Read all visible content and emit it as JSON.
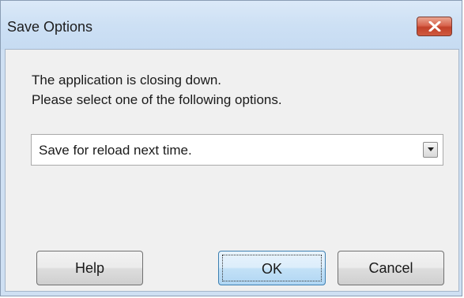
{
  "window": {
    "title": "Save Options",
    "close_icon": "close-x-icon"
  },
  "message": {
    "line1": "The application is closing down.",
    "line2": "Please select one of the following options."
  },
  "options_dropdown": {
    "selected_value": "Save for reload next time.",
    "arrow_icon": "chevron-down-icon"
  },
  "buttons": {
    "help_label": "Help",
    "ok_label": "OK",
    "cancel_label": "Cancel"
  },
  "colors": {
    "titlebar": "#cfe0f3",
    "close_button": "#c94a33",
    "dialog_body": "#f0f0f0",
    "default_button_border": "#3c7fb1"
  }
}
